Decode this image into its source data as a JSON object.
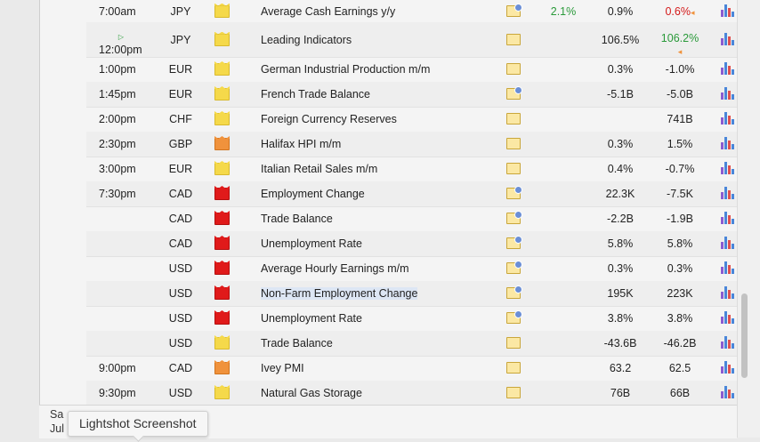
{
  "rows": [
    {
      "time": "7:00am",
      "currency": "JPY",
      "impact": "yellow",
      "event": "Average Cash Earnings y/y",
      "detail": "chart",
      "actual": "2.1%",
      "forecast": "0.9%",
      "previous": "0.6%",
      "previous_color": "red",
      "previous_marker": "◂"
    },
    {
      "time_marker": "▷",
      "time": "12:00pm",
      "currency": "JPY",
      "impact": "yellow",
      "event": "Leading Indicators",
      "detail": "folder",
      "actual": "",
      "forecast": "106.5%",
      "previous": "106.2%",
      "previous_color": "green",
      "previous_marker": "◂"
    },
    {
      "time": "1:00pm",
      "currency": "EUR",
      "impact": "yellow",
      "event": "German Industrial Production m/m",
      "detail": "folder",
      "actual": "",
      "forecast": "0.3%",
      "previous": "-1.0%"
    },
    {
      "time": "1:45pm",
      "currency": "EUR",
      "impact": "yellow",
      "event": "French Trade Balance",
      "detail": "chart",
      "actual": "",
      "forecast": "-5.1B",
      "previous": "-5.0B"
    },
    {
      "time": "2:00pm",
      "currency": "CHF",
      "impact": "yellow",
      "event": "Foreign Currency Reserves",
      "detail": "folder",
      "actual": "",
      "forecast": "",
      "previous": "741B"
    },
    {
      "time": "2:30pm",
      "currency": "GBP",
      "impact": "orange",
      "event": "Halifax HPI m/m",
      "detail": "folder",
      "actual": "",
      "forecast": "0.3%",
      "previous": "1.5%"
    },
    {
      "time": "3:00pm",
      "currency": "EUR",
      "impact": "yellow",
      "event": "Italian Retail Sales m/m",
      "detail": "folder",
      "actual": "",
      "forecast": "0.4%",
      "previous": "-0.7%"
    },
    {
      "time": "7:30pm",
      "currency": "CAD",
      "impact": "red",
      "event": "Employment Change",
      "detail": "chart",
      "actual": "",
      "forecast": "22.3K",
      "previous": "-7.5K"
    },
    {
      "time": "",
      "currency": "CAD",
      "impact": "red",
      "event": "Trade Balance",
      "detail": "chart",
      "actual": "",
      "forecast": "-2.2B",
      "previous": "-1.9B"
    },
    {
      "time": "",
      "currency": "CAD",
      "impact": "red",
      "event": "Unemployment Rate",
      "detail": "chart",
      "actual": "",
      "forecast": "5.8%",
      "previous": "5.8%"
    },
    {
      "time": "",
      "currency": "USD",
      "impact": "red",
      "event": "Average Hourly Earnings m/m",
      "detail": "chart",
      "actual": "",
      "forecast": "0.3%",
      "previous": "0.3%"
    },
    {
      "time": "",
      "currency": "USD",
      "impact": "red",
      "event": "Non-Farm Employment Change",
      "detail": "chart",
      "actual": "",
      "forecast": "195K",
      "previous": "223K",
      "highlight": true
    },
    {
      "time": "",
      "currency": "USD",
      "impact": "red",
      "event": "Unemployment Rate",
      "detail": "chart",
      "actual": "",
      "forecast": "3.8%",
      "previous": "3.8%"
    },
    {
      "time": "",
      "currency": "USD",
      "impact": "yellow",
      "event": "Trade Balance",
      "detail": "folder",
      "actual": "",
      "forecast": "-43.6B",
      "previous": "-46.2B"
    },
    {
      "time": "9:00pm",
      "currency": "CAD",
      "impact": "orange",
      "event": "Ivey PMI",
      "detail": "folder",
      "actual": "",
      "forecast": "63.2",
      "previous": "62.5"
    },
    {
      "time": "9:30pm",
      "currency": "USD",
      "impact": "yellow",
      "event": "Natural Gas Storage",
      "detail": "folder",
      "actual": "",
      "forecast": "76B",
      "previous": "66B"
    }
  ],
  "next_day": {
    "day": "Sa",
    "month": "Jul"
  },
  "tooltip": "Lightshot Screenshot"
}
